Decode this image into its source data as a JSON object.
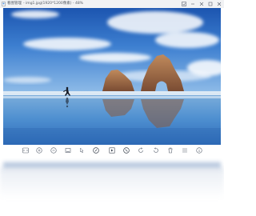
{
  "window": {
    "app_name": "看图管理",
    "file_info": "- img1.jpg(1920*1200像素) - 48%"
  },
  "titlebar_buttons": [
    {
      "name": "screenshot-icon"
    },
    {
      "name": "minimize-icon"
    },
    {
      "name": "pin-icon"
    },
    {
      "name": "maximize-icon"
    },
    {
      "name": "close-icon"
    }
  ],
  "toolbar": [
    {
      "name": "original-size-icon"
    },
    {
      "name": "zoom-in-icon"
    },
    {
      "name": "zoom-out-icon"
    },
    {
      "name": "fit-window-icon"
    },
    {
      "name": "pointer-icon"
    },
    {
      "name": "edit-icon"
    },
    {
      "name": "slideshow-icon"
    },
    {
      "name": "brush-icon"
    },
    {
      "name": "rotate-left-icon"
    },
    {
      "name": "rotate-right-icon"
    },
    {
      "name": "delete-icon"
    },
    {
      "name": "menu-icon"
    },
    {
      "name": "info-icon"
    }
  ],
  "colors": {
    "titlebar_bg": "#f1f2f4",
    "icon_color": "#5a6270",
    "sky_top": "#1c55b0",
    "sky_bottom": "#7fb1e6",
    "rock": "#a2684a"
  }
}
